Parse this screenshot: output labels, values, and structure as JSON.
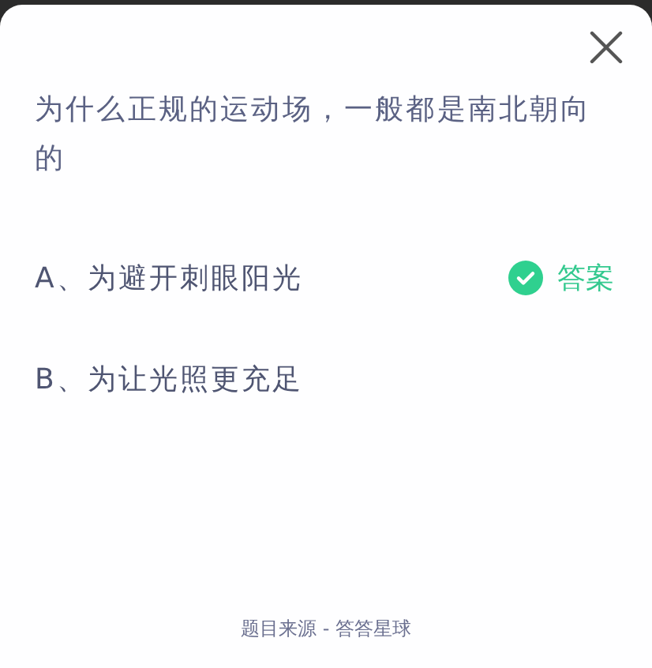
{
  "question": "为什么正规的运动场，一般都是南北朝向的",
  "options": [
    {
      "text": "A、为避开刺眼阳光",
      "correct": true,
      "answer_label": "答案"
    },
    {
      "text": "B、为让光照更充足",
      "correct": false
    }
  ],
  "footer": "题目来源 - 答答星球"
}
